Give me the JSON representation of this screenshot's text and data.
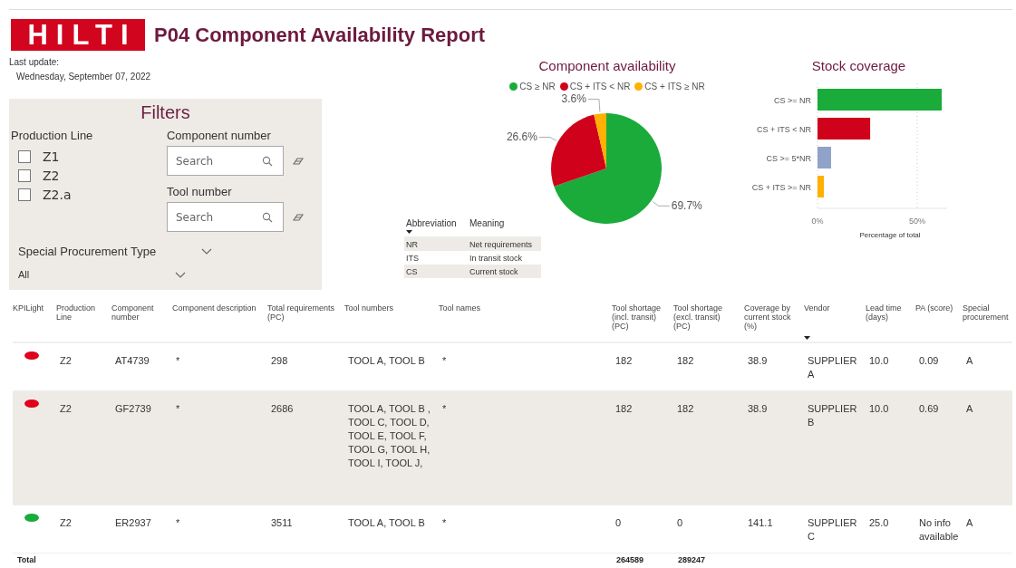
{
  "header": {
    "logo": "HILTI",
    "title": "P04 Component Availability Report"
  },
  "last_update": {
    "label": "Last update:",
    "date": "Wednesday, September 07, 2022"
  },
  "filters": {
    "title": "Filters",
    "production_line": {
      "label": "Production Line",
      "options": [
        {
          "label": "Z1",
          "checked": false
        },
        {
          "label": "Z2",
          "checked": false
        },
        {
          "label": "Z2.a",
          "checked": false
        }
      ]
    },
    "component_number": {
      "label": "Component number",
      "placeholder": "Search"
    },
    "tool_number": {
      "label": "Tool number",
      "placeholder": "Search"
    },
    "special_procurement": {
      "label": "Special Procurement Type",
      "value": "All"
    }
  },
  "availability_chart": {
    "chart_data": {
      "type": "pie",
      "title": "Component availability",
      "legend": true,
      "categories": [
        "CS ≥ NR",
        "CS + ITS < NR",
        "CS + ITS ≥ NR"
      ],
      "colors": [
        "#1aab3a",
        "#d0021b",
        "#ffb000"
      ],
      "values": [
        69.7,
        26.6,
        3.6
      ],
      "value_labels": [
        "69.7%",
        "26.6%",
        "3.6%"
      ]
    }
  },
  "abbreviations": {
    "columns": [
      {
        "label": "Abbreviation",
        "sorted": true
      },
      {
        "label": "Meaning",
        "sorted": false
      }
    ],
    "rows": [
      [
        "NR",
        "Net requirements"
      ],
      [
        "ITS",
        "In transit stock"
      ],
      [
        "CS",
        "Current stock"
      ]
    ]
  },
  "coverage_chart": {
    "chart_data": {
      "type": "bar",
      "orientation": "horizontal",
      "title": "Stock coverage",
      "xlabel": "Percentage of total",
      "categories": [
        "CS >= NR",
        "CS + ITS < NR",
        "CS >= 5*NR",
        "CS + ITS >= NR"
      ],
      "colors": [
        "#1aab3a",
        "#d0021b",
        "#8fa3c8",
        "#ffb000"
      ],
      "values": [
        62.3,
        26.4,
        6.8,
        3.2
      ],
      "xlim": [
        0,
        65
      ],
      "xticks": [
        {
          "value": 0,
          "label": "0%"
        },
        {
          "value": 50,
          "label": "50%"
        }
      ]
    }
  },
  "table": {
    "columns": [
      {
        "label": "KPILight",
        "sorted": false,
        "total": "Total"
      },
      {
        "label": "Production Line",
        "sorted": false
      },
      {
        "label": "Component number",
        "sorted": false
      },
      {
        "label": "Component description",
        "sorted": false
      },
      {
        "label": "Total requirements (PC)",
        "sorted": false
      },
      {
        "label": "Tool numbers",
        "sorted": false
      },
      {
        "label": "Tool names",
        "sorted": false
      },
      {
        "label": "Tool shortage (incl. transit) (PC)",
        "sorted": false,
        "total": "264589"
      },
      {
        "label": "Tool shortage (excl. transit) (PC)",
        "sorted": false,
        "total": "289247"
      },
      {
        "label": "Coverage by current stock (%)",
        "sorted": false
      },
      {
        "label": "Vendor",
        "sorted": true
      },
      {
        "label": "Lead time (days)",
        "sorted": false
      },
      {
        "label": "PA (score)",
        "sorted": false
      },
      {
        "label": "Special procurement",
        "sorted": false
      }
    ],
    "rows": [
      {
        "color": "#e0001b",
        "cells": [
          "",
          "Z2",
          "AT4739",
          "*",
          "298",
          "TOOL A, TOOL B",
          "*",
          "182",
          "182",
          "38.9",
          "SUPPLIER A",
          "10.0",
          "0.09",
          "A"
        ]
      },
      {
        "color": "#e0001b",
        "cells": [
          "",
          "Z2",
          "GF2739",
          "*",
          "2686",
          "TOOL A, TOOL B , TOOL C, TOOL D, TOOL E, TOOL F, TOOL G, TOOL H, TOOL I, TOOL J,",
          "*",
          "182",
          "182",
          "38.9",
          "SUPPLIER B",
          "10.0",
          "0.69",
          "A"
        ]
      },
      {
        "color": "#1aab3a",
        "cells": [
          "",
          "Z2",
          "ER2937",
          "*",
          "3511",
          "TOOL A, TOOL B",
          "*",
          "0",
          "0",
          "141.1",
          "SUPPLIER C",
          "25.0",
          "No info available",
          "A"
        ]
      }
    ]
  }
}
